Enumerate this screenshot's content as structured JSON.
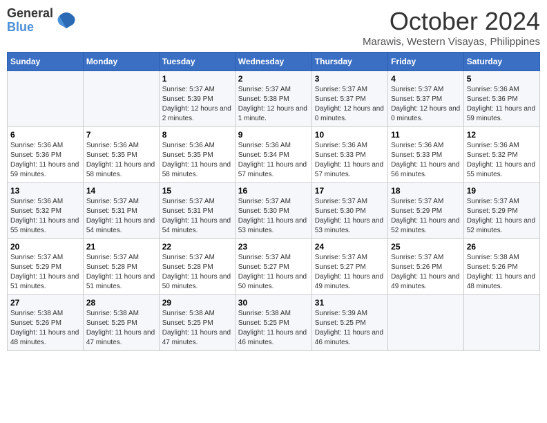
{
  "logo": {
    "line1": "General",
    "line2": "Blue"
  },
  "title": "October 2024",
  "location": "Marawis, Western Visayas, Philippines",
  "headers": [
    "Sunday",
    "Monday",
    "Tuesday",
    "Wednesday",
    "Thursday",
    "Friday",
    "Saturday"
  ],
  "weeks": [
    [
      {
        "day": "",
        "sunrise": "",
        "sunset": "",
        "daylight": ""
      },
      {
        "day": "",
        "sunrise": "",
        "sunset": "",
        "daylight": ""
      },
      {
        "day": "1",
        "sunrise": "Sunrise: 5:37 AM",
        "sunset": "Sunset: 5:39 PM",
        "daylight": "Daylight: 12 hours and 2 minutes."
      },
      {
        "day": "2",
        "sunrise": "Sunrise: 5:37 AM",
        "sunset": "Sunset: 5:38 PM",
        "daylight": "Daylight: 12 hours and 1 minute."
      },
      {
        "day": "3",
        "sunrise": "Sunrise: 5:37 AM",
        "sunset": "Sunset: 5:37 PM",
        "daylight": "Daylight: 12 hours and 0 minutes."
      },
      {
        "day": "4",
        "sunrise": "Sunrise: 5:37 AM",
        "sunset": "Sunset: 5:37 PM",
        "daylight": "Daylight: 12 hours and 0 minutes."
      },
      {
        "day": "5",
        "sunrise": "Sunrise: 5:36 AM",
        "sunset": "Sunset: 5:36 PM",
        "daylight": "Daylight: 11 hours and 59 minutes."
      }
    ],
    [
      {
        "day": "6",
        "sunrise": "Sunrise: 5:36 AM",
        "sunset": "Sunset: 5:36 PM",
        "daylight": "Daylight: 11 hours and 59 minutes."
      },
      {
        "day": "7",
        "sunrise": "Sunrise: 5:36 AM",
        "sunset": "Sunset: 5:35 PM",
        "daylight": "Daylight: 11 hours and 58 minutes."
      },
      {
        "day": "8",
        "sunrise": "Sunrise: 5:36 AM",
        "sunset": "Sunset: 5:35 PM",
        "daylight": "Daylight: 11 hours and 58 minutes."
      },
      {
        "day": "9",
        "sunrise": "Sunrise: 5:36 AM",
        "sunset": "Sunset: 5:34 PM",
        "daylight": "Daylight: 11 hours and 57 minutes."
      },
      {
        "day": "10",
        "sunrise": "Sunrise: 5:36 AM",
        "sunset": "Sunset: 5:33 PM",
        "daylight": "Daylight: 11 hours and 57 minutes."
      },
      {
        "day": "11",
        "sunrise": "Sunrise: 5:36 AM",
        "sunset": "Sunset: 5:33 PM",
        "daylight": "Daylight: 11 hours and 56 minutes."
      },
      {
        "day": "12",
        "sunrise": "Sunrise: 5:36 AM",
        "sunset": "Sunset: 5:32 PM",
        "daylight": "Daylight: 11 hours and 55 minutes."
      }
    ],
    [
      {
        "day": "13",
        "sunrise": "Sunrise: 5:36 AM",
        "sunset": "Sunset: 5:32 PM",
        "daylight": "Daylight: 11 hours and 55 minutes."
      },
      {
        "day": "14",
        "sunrise": "Sunrise: 5:37 AM",
        "sunset": "Sunset: 5:31 PM",
        "daylight": "Daylight: 11 hours and 54 minutes."
      },
      {
        "day": "15",
        "sunrise": "Sunrise: 5:37 AM",
        "sunset": "Sunset: 5:31 PM",
        "daylight": "Daylight: 11 hours and 54 minutes."
      },
      {
        "day": "16",
        "sunrise": "Sunrise: 5:37 AM",
        "sunset": "Sunset: 5:30 PM",
        "daylight": "Daylight: 11 hours and 53 minutes."
      },
      {
        "day": "17",
        "sunrise": "Sunrise: 5:37 AM",
        "sunset": "Sunset: 5:30 PM",
        "daylight": "Daylight: 11 hours and 53 minutes."
      },
      {
        "day": "18",
        "sunrise": "Sunrise: 5:37 AM",
        "sunset": "Sunset: 5:29 PM",
        "daylight": "Daylight: 11 hours and 52 minutes."
      },
      {
        "day": "19",
        "sunrise": "Sunrise: 5:37 AM",
        "sunset": "Sunset: 5:29 PM",
        "daylight": "Daylight: 11 hours and 52 minutes."
      }
    ],
    [
      {
        "day": "20",
        "sunrise": "Sunrise: 5:37 AM",
        "sunset": "Sunset: 5:29 PM",
        "daylight": "Daylight: 11 hours and 51 minutes."
      },
      {
        "day": "21",
        "sunrise": "Sunrise: 5:37 AM",
        "sunset": "Sunset: 5:28 PM",
        "daylight": "Daylight: 11 hours and 51 minutes."
      },
      {
        "day": "22",
        "sunrise": "Sunrise: 5:37 AM",
        "sunset": "Sunset: 5:28 PM",
        "daylight": "Daylight: 11 hours and 50 minutes."
      },
      {
        "day": "23",
        "sunrise": "Sunrise: 5:37 AM",
        "sunset": "Sunset: 5:27 PM",
        "daylight": "Daylight: 11 hours and 50 minutes."
      },
      {
        "day": "24",
        "sunrise": "Sunrise: 5:37 AM",
        "sunset": "Sunset: 5:27 PM",
        "daylight": "Daylight: 11 hours and 49 minutes."
      },
      {
        "day": "25",
        "sunrise": "Sunrise: 5:37 AM",
        "sunset": "Sunset: 5:26 PM",
        "daylight": "Daylight: 11 hours and 49 minutes."
      },
      {
        "day": "26",
        "sunrise": "Sunrise: 5:38 AM",
        "sunset": "Sunset: 5:26 PM",
        "daylight": "Daylight: 11 hours and 48 minutes."
      }
    ],
    [
      {
        "day": "27",
        "sunrise": "Sunrise: 5:38 AM",
        "sunset": "Sunset: 5:26 PM",
        "daylight": "Daylight: 11 hours and 48 minutes."
      },
      {
        "day": "28",
        "sunrise": "Sunrise: 5:38 AM",
        "sunset": "Sunset: 5:25 PM",
        "daylight": "Daylight: 11 hours and 47 minutes."
      },
      {
        "day": "29",
        "sunrise": "Sunrise: 5:38 AM",
        "sunset": "Sunset: 5:25 PM",
        "daylight": "Daylight: 11 hours and 47 minutes."
      },
      {
        "day": "30",
        "sunrise": "Sunrise: 5:38 AM",
        "sunset": "Sunset: 5:25 PM",
        "daylight": "Daylight: 11 hours and 46 minutes."
      },
      {
        "day": "31",
        "sunrise": "Sunrise: 5:39 AM",
        "sunset": "Sunset: 5:25 PM",
        "daylight": "Daylight: 11 hours and 46 minutes."
      },
      {
        "day": "",
        "sunrise": "",
        "sunset": "",
        "daylight": ""
      },
      {
        "day": "",
        "sunrise": "",
        "sunset": "",
        "daylight": ""
      }
    ]
  ]
}
